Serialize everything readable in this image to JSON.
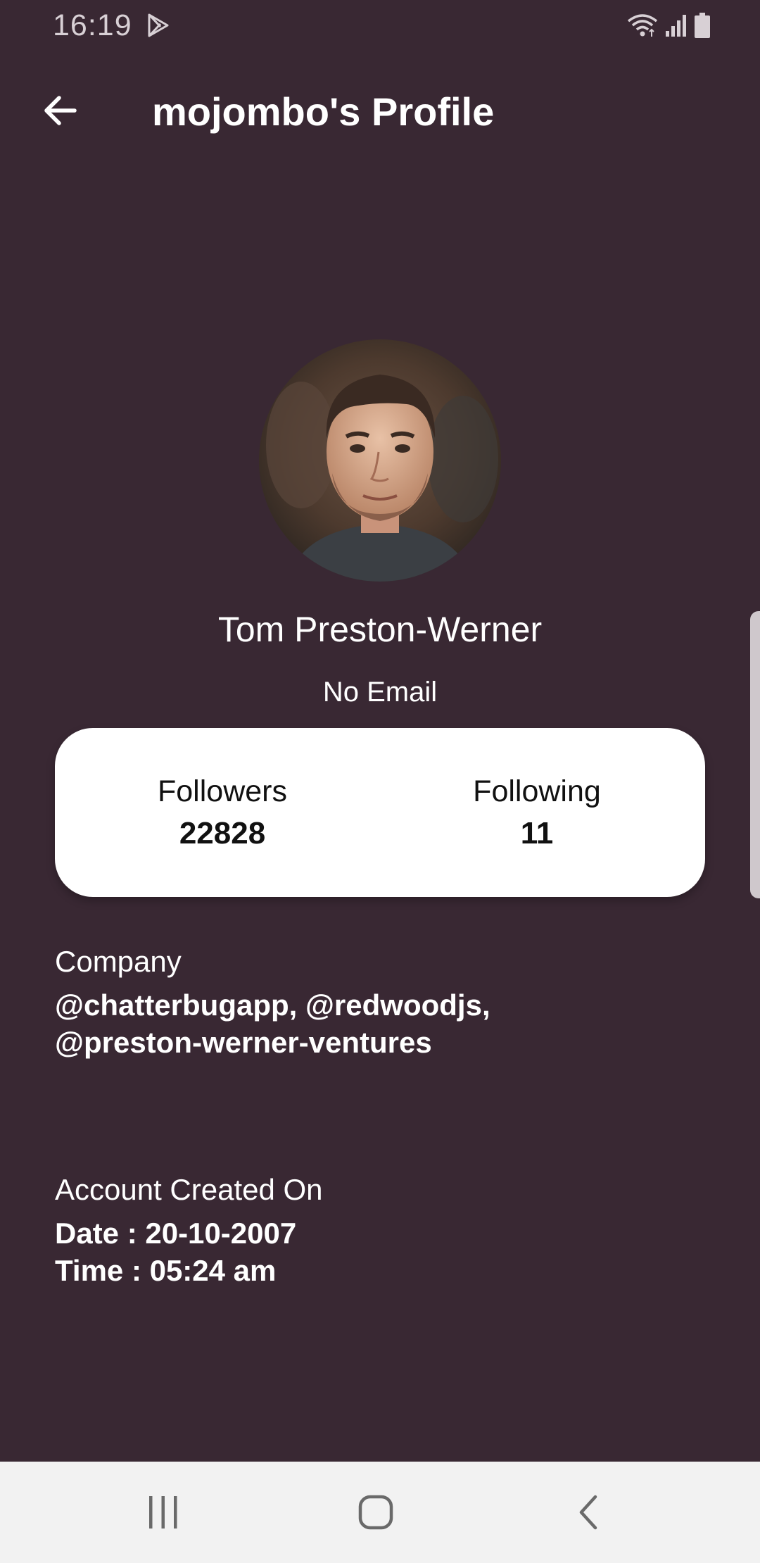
{
  "status_bar": {
    "time": "16:19",
    "icons": [
      "play-store-icon",
      "wifi-icon",
      "signal-icon",
      "battery-icon"
    ]
  },
  "app_bar": {
    "title": "mojombo's Profile",
    "back_icon": "arrow-left-icon"
  },
  "profile": {
    "name": "Tom Preston-Werner",
    "email": "No Email"
  },
  "stats": {
    "followers_label": "Followers",
    "followers_value": "22828",
    "following_label": "Following",
    "following_value": "11"
  },
  "company": {
    "label": "Company",
    "line1": "@chatterbugapp, @redwoodjs,",
    "line2": "@preston-werner-ventures"
  },
  "account": {
    "label": "Account Created On",
    "date": "Date : 20-10-2007",
    "time": "Time : 05:24 am"
  },
  "nav_bar": {
    "buttons": [
      "recent-apps-icon",
      "home-icon",
      "back-chevron-icon"
    ]
  },
  "colors": {
    "background": "#392833",
    "card": "#ffffff",
    "nav_bar": "#f2f2f2"
  }
}
